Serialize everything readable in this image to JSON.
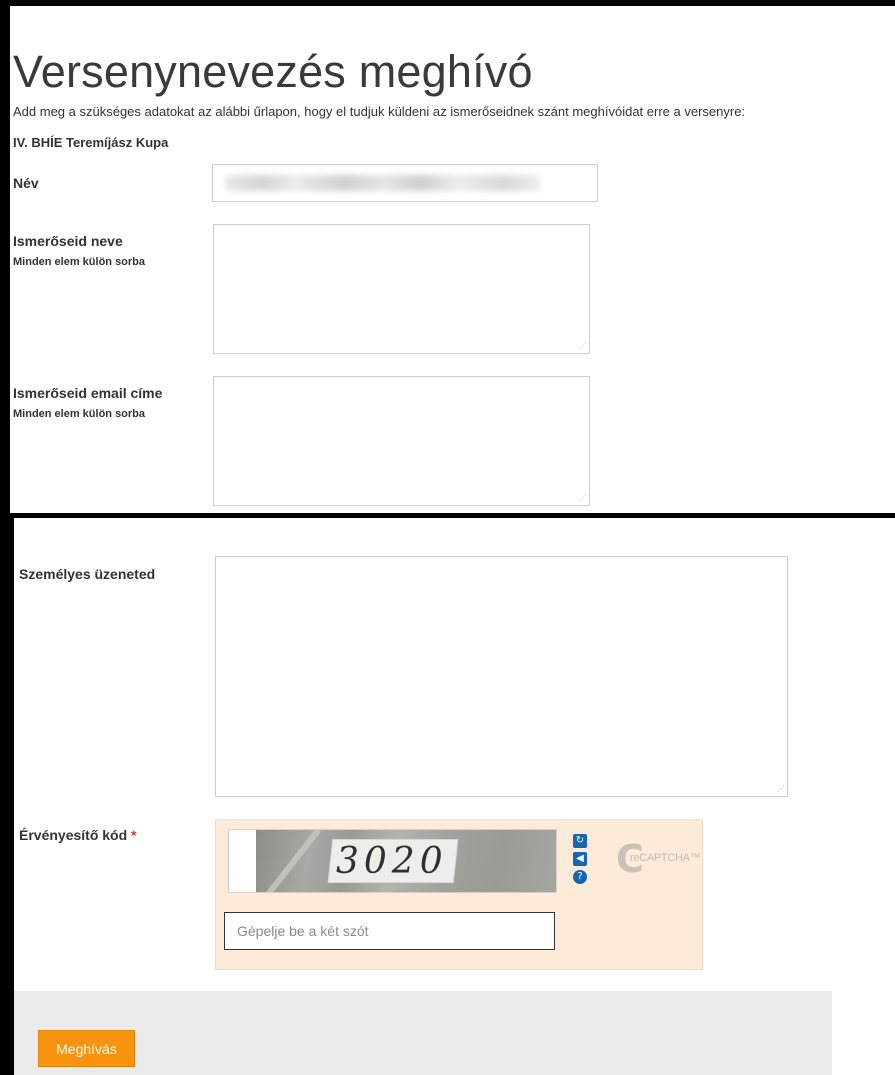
{
  "header": {
    "title": "Versenynevezés meghívó",
    "intro": "Add meg a szükséges adatokat az alábbi űrlapon, hogy el tudjuk küldeni az ismerőseidnek szánt meghívóidat erre a versenyre:",
    "event_name": "IV. BHÍE Teremíjász Kupa"
  },
  "form": {
    "name_label": "Név",
    "friends_names_label": "Ismerőseid neve",
    "friends_names_hint": "Minden elem külön sorba",
    "friends_emails_label": "Ismerőseid email címe",
    "friends_emails_hint": "Minden elem külön sorba",
    "message_label": "Személyes üzeneted",
    "captcha_label": "Érvényesítő kód",
    "required_marker": "*"
  },
  "captcha": {
    "image_text": "3020",
    "input_placeholder": "Gépelje be a két szót",
    "brand": "reCAPTCHA™",
    "controls": [
      "refresh-icon",
      "audio-icon",
      "help-icon"
    ]
  },
  "footer": {
    "submit_label": "Meghívás"
  },
  "colors": {
    "accent": "#f7930f",
    "captcha_bg": "#fbebd8",
    "captcha_controls": "#1467b0",
    "footer_bg": "#ebebeb"
  }
}
